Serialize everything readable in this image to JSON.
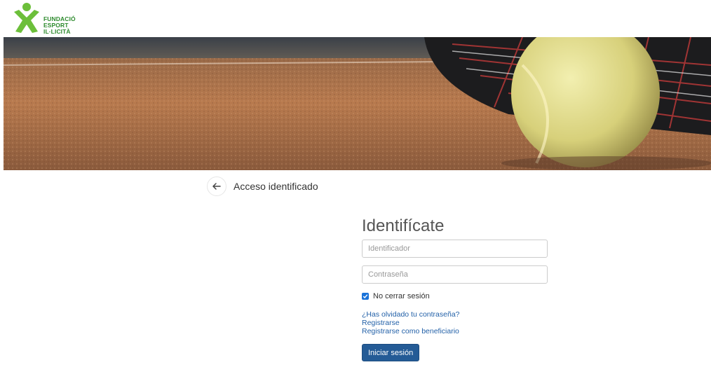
{
  "header": {
    "logo_lines": [
      "FUNDACIÓ",
      "ESPORT",
      "IL·LICITÀ"
    ],
    "logo_color": "#2e8b2e"
  },
  "nav": {
    "back_icon": "arrow-left-icon",
    "page_title": "Acceso identificado"
  },
  "login": {
    "title": "Identifícate",
    "username_placeholder": "Identificador",
    "username_value": "",
    "password_placeholder": "Contraseña",
    "password_value": "",
    "remember_label": "No cerrar sesión",
    "remember_checked": true,
    "forgot_link": "¿Has olvidado tu contraseña?",
    "register_link": "Registrarse",
    "register_beneficiary_link": "Registrarse como beneficiario",
    "submit_label": "Iniciar sesión"
  },
  "colors": {
    "primary_button": "#245b96",
    "link": "#2361a8",
    "checkbox": "#1a73d9"
  }
}
